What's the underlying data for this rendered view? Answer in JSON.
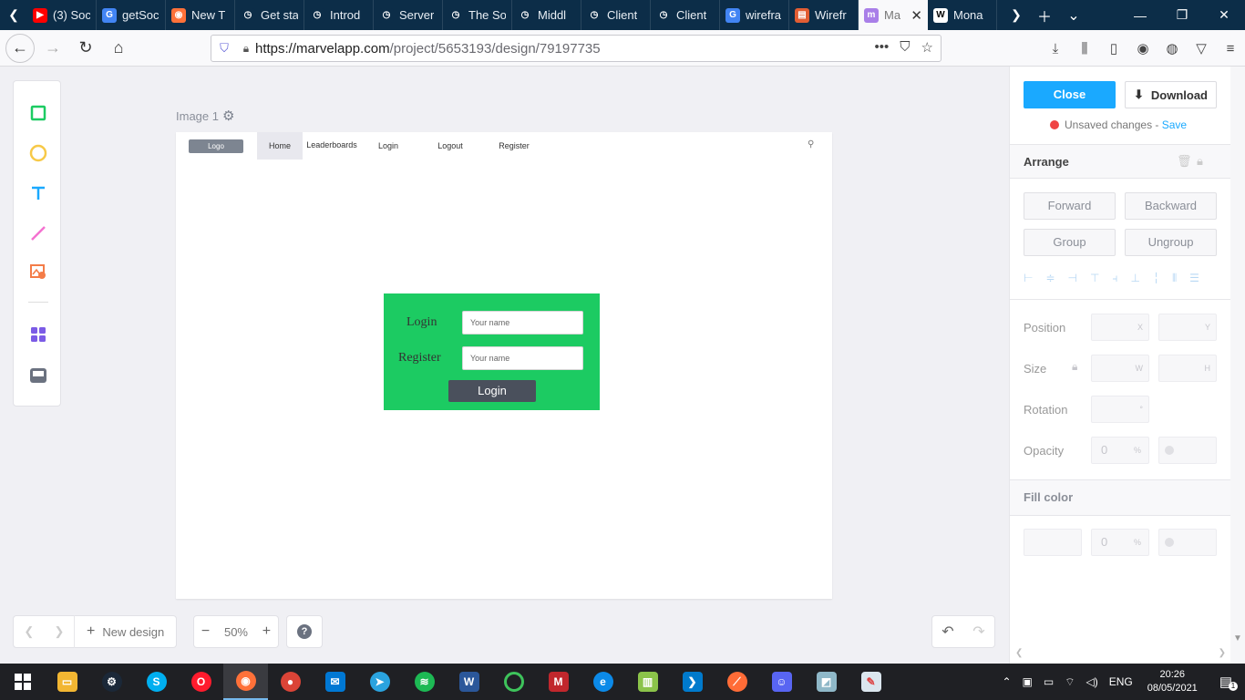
{
  "browser": {
    "tabs": [
      {
        "title": "(3) Soc",
        "icon": "youtube-icon",
        "color": "#ff0000",
        "glyph": "▶"
      },
      {
        "title": "getSoc",
        "icon": "google-icon",
        "color": "#4285f4",
        "glyph": "G"
      },
      {
        "title": "New T",
        "icon": "firefox-icon",
        "color": "#ff7139",
        "glyph": "◉"
      },
      {
        "title": "Get sta",
        "icon": "clock-icon",
        "color": "#0c2d48",
        "glyph": "◷"
      },
      {
        "title": "Introd",
        "icon": "clock-icon",
        "color": "#0c2d48",
        "glyph": "◷"
      },
      {
        "title": "Server",
        "icon": "clock-icon",
        "color": "#0c2d48",
        "glyph": "◷"
      },
      {
        "title": "The So",
        "icon": "clock-icon",
        "color": "#0c2d48",
        "glyph": "◷"
      },
      {
        "title": "Middl",
        "icon": "clock-icon",
        "color": "#0c2d48",
        "glyph": "◷"
      },
      {
        "title": "Client",
        "icon": "clock-icon",
        "color": "#0c2d48",
        "glyph": "◷"
      },
      {
        "title": "Client",
        "icon": "clock-icon",
        "color": "#0c2d48",
        "glyph": "◷"
      },
      {
        "title": "wirefra",
        "icon": "google-icon",
        "color": "#4285f4",
        "glyph": "G"
      },
      {
        "title": "Wirefr",
        "icon": "wireframe-icon",
        "color": "#e25d33",
        "glyph": "▤"
      },
      {
        "title": "Ma",
        "icon": "marvel-icon",
        "color": "#a97fe8",
        "glyph": "m",
        "active": true
      },
      {
        "title": "Mona",
        "icon": "wikipedia-icon",
        "color": "#ffffff",
        "glyph": "W"
      }
    ],
    "url_host": "https://marvelapp.com",
    "url_path": "/project/5653193/design/79197735"
  },
  "canvas": {
    "image_label": "Image 1",
    "artboard": {
      "logo": "Logo",
      "nav": {
        "home": "Home",
        "leaderboards": "Leaderboards",
        "login": "Login",
        "logout": "Logout",
        "register": "Register"
      },
      "form": {
        "login_label": "Login",
        "register_label": "Register",
        "login_placeholder": "Your name",
        "register_placeholder": "Your name",
        "button": "Login",
        "bg_color": "#1ccb62"
      }
    }
  },
  "bottom": {
    "new_design": "New design",
    "zoom": "50%"
  },
  "panel": {
    "close": "Close",
    "download": "Download",
    "unsaved": "Unsaved changes",
    "separator": " - ",
    "save": "Save",
    "arrange": "Arrange",
    "forward": "Forward",
    "backward": "Backward",
    "group": "Group",
    "ungroup": "Ungroup",
    "position": "Position",
    "size": "Size",
    "rotation": "Rotation",
    "opacity": "Opacity",
    "fill_color": "Fill color",
    "x_suffix": "X",
    "y_suffix": "Y",
    "w_suffix": "W",
    "h_suffix": "H",
    "deg_suffix": "°",
    "opacity_value": "0",
    "pct": "%",
    "fill_opacity": "0",
    "accent": "#1aa9ff"
  },
  "taskbar": {
    "lang": "ENG",
    "time": "20:26",
    "date": "08/05/2021",
    "notifications": "1"
  }
}
